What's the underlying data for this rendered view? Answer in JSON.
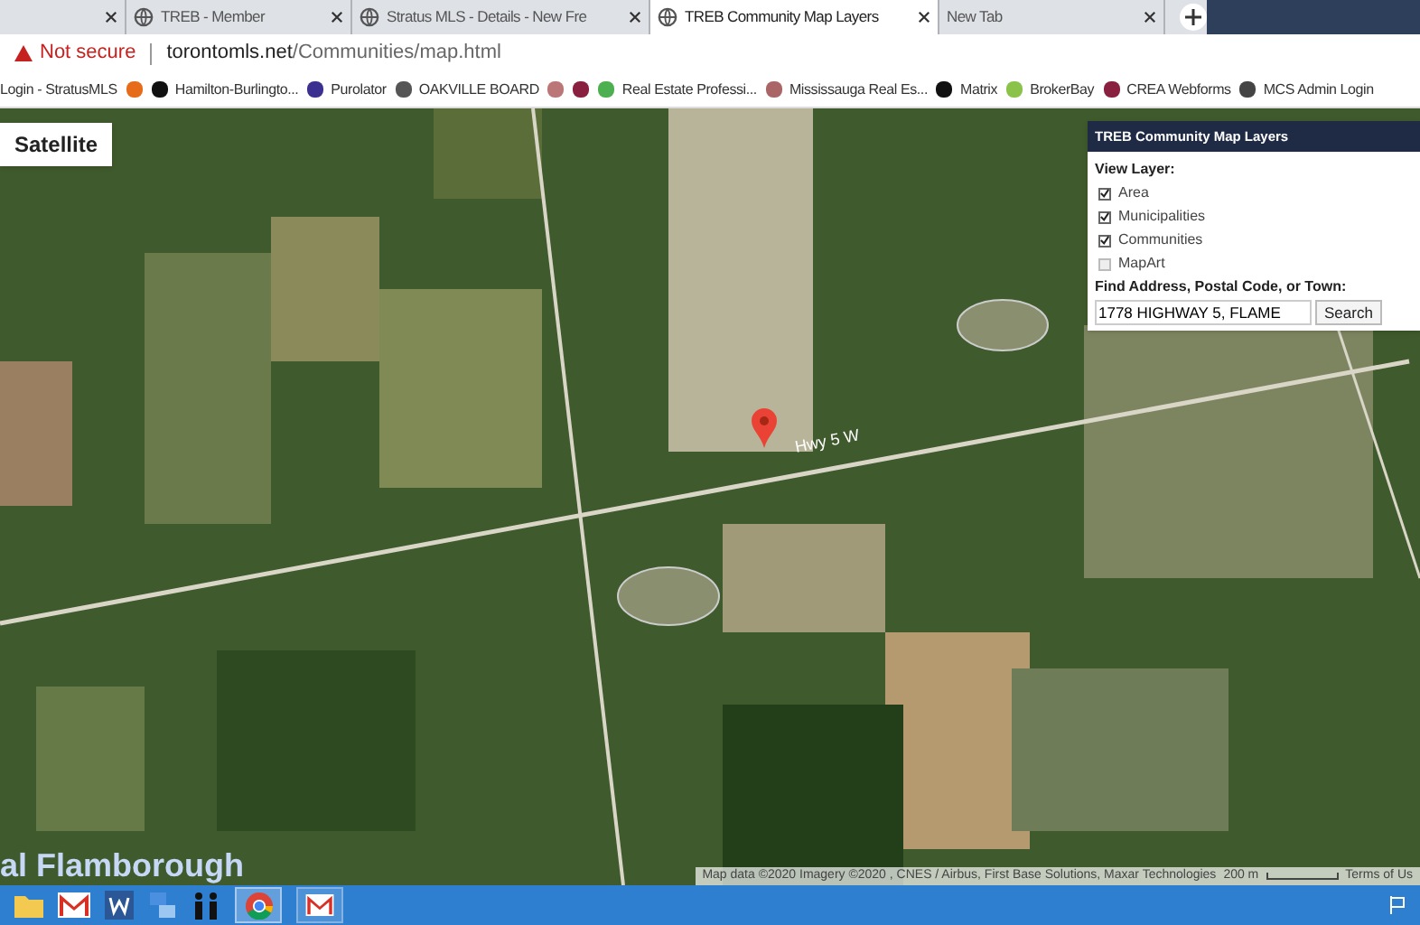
{
  "tabs": [
    {
      "selected": false
    },
    {
      "title": "TREB - Member",
      "selected": false
    },
    {
      "title": "Stratus MLS - Details - New Fre",
      "selected": false
    },
    {
      "title": "TREB Community Map Layers",
      "selected": true
    },
    {
      "title": "New Tab",
      "selected": false
    }
  ],
  "address_bar": {
    "security": "Not secure",
    "host": "torontomls.net",
    "path": "/Communities/map.html"
  },
  "bookmarks": [
    {
      "kind": "text",
      "label": "Login - StratusMLS"
    },
    {
      "kind": "icon"
    },
    {
      "kind": "labeled",
      "label": "Hamilton-Burlingto..."
    },
    {
      "kind": "labeled",
      "label": "Purolator"
    },
    {
      "kind": "labeled",
      "label": "OAKVILLE BOARD"
    },
    {
      "kind": "icon"
    },
    {
      "kind": "icon"
    },
    {
      "kind": "labeled",
      "label": "Real Estate Professi..."
    },
    {
      "kind": "labeled",
      "label": "Mississauga Real Es..."
    },
    {
      "kind": "labeled",
      "label": "Matrix"
    },
    {
      "kind": "labeled",
      "label": "BrokerBay"
    },
    {
      "kind": "labeled",
      "label": "CREA Webforms"
    },
    {
      "kind": "labeled",
      "label": "MCS Admin Login"
    }
  ],
  "map": {
    "map_type_button": "Satellite",
    "road_label": "Hwy 5 W",
    "place_label": "al Flamborough",
    "attribution": "Map data ©2020 Imagery ©2020 , CNES / Airbus, First Base Solutions, Maxar Technologies",
    "scale": "200 m",
    "terms": "Terms of Us"
  },
  "layers_panel": {
    "title": "TREB Community Map Layers",
    "view_layer_label": "View Layer:",
    "layers": [
      {
        "label": "Area",
        "checked": true
      },
      {
        "label": "Municipalities",
        "checked": true
      },
      {
        "label": "Communities",
        "checked": true
      },
      {
        "label": "MapArt",
        "checked": false
      }
    ],
    "find_label": "Find Address, Postal Code, or Town:",
    "search_value": "1778 HIGHWAY 5, FLAME",
    "search_button": "Search"
  }
}
